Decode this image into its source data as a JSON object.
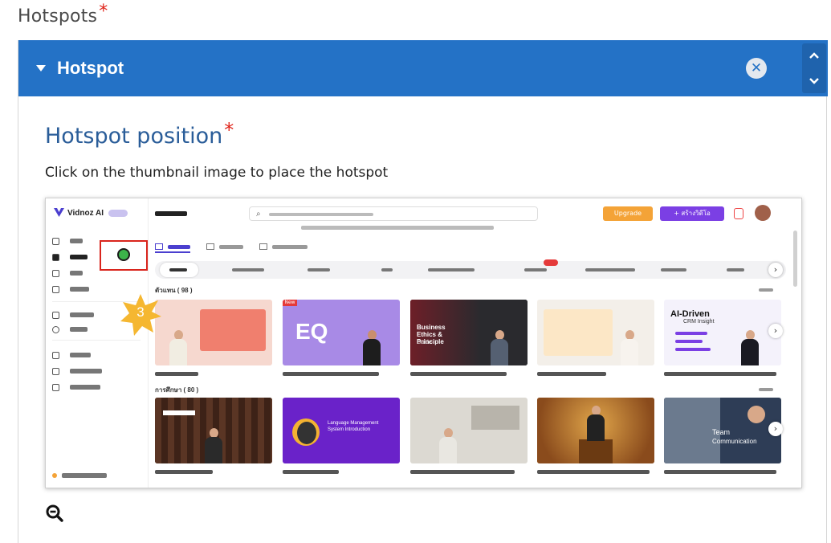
{
  "section": {
    "label": "Hotspots",
    "required_mark": "*"
  },
  "panel": {
    "title": "Hotspot",
    "close_glyph": "✕",
    "icons": {
      "collapse": "caret-down-icon",
      "close": "close-circle-icon",
      "up": "chevron-up-icon",
      "down": "chevron-down-icon"
    },
    "header_color": "#2472c6"
  },
  "field": {
    "title": "Hotspot position",
    "required_mark": "*",
    "description": "Click on the thumbnail image to place the hotspot"
  },
  "thumbnail": {
    "app_brand": "Vidnoz AI",
    "upgrade_label": "Upgrade",
    "create_label": "+ สร้างวิดีโอ",
    "section_label_1": "ตัวแทน ( 98 )",
    "section_label_2": "การศึกษา ( 80 )",
    "card_texts": {
      "card_3_title": "Business Ethics & Principle",
      "card_3_sub": "Guide",
      "card_5_title": "AI-Driven",
      "card_5_sub": "CRM Insight",
      "card_10_title": "Team",
      "card_10_sub": "Communication",
      "card_7_title": "Language Management System Introduction",
      "card_2_letters": "EQ"
    },
    "new_badge": "New",
    "hotspot_marker_color": "#3cb34a",
    "selection_color": "#d9251d"
  },
  "hotspot_marker": {
    "number": "3",
    "color": "#f5b731"
  },
  "zoom": {
    "icon": "zoom-out-icon"
  }
}
